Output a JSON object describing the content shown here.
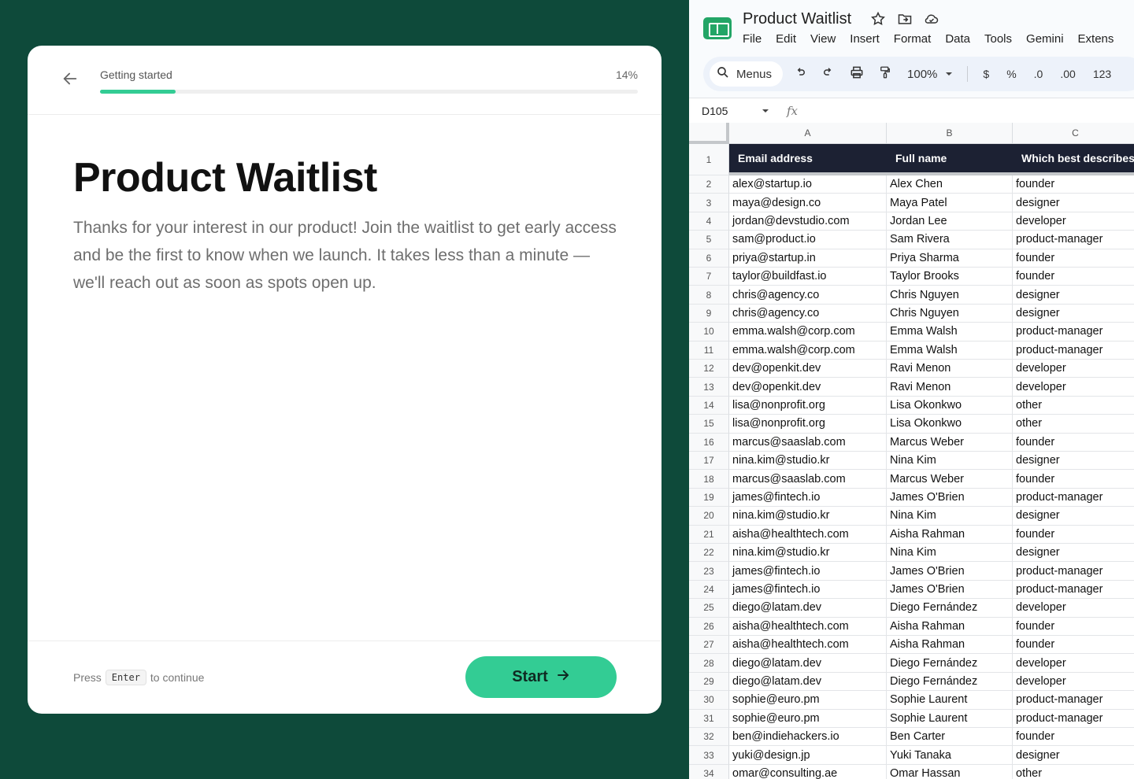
{
  "form": {
    "back_icon": "arrow-left-icon",
    "progress_label": "Getting started",
    "progress_percent": "14%",
    "progress_value": 0.14,
    "title": "Product Waitlist",
    "description": "Thanks for your interest in our product! Join the waitlist to get early access and be the first to know when we launch. It takes less than a minute — we'll reach out as soon as spots open up.",
    "hint_press": "Press",
    "hint_key": "Enter",
    "hint_continue": "to continue",
    "start_label": "Start",
    "start_icon": "arrow-right-icon",
    "accent_color": "#33cc94"
  },
  "sheet": {
    "title": "Product Waitlist",
    "menu": [
      "File",
      "Edit",
      "View",
      "Insert",
      "Format",
      "Data",
      "Tools",
      "Gemini",
      "Extens"
    ],
    "toolbar": {
      "search_label": "Menus",
      "zoom": "100%",
      "currency": "$",
      "percent": "%",
      "decrease_decimal": ".0",
      "increase_decimal": ".00",
      "number_format": "123"
    },
    "name_box": "D105",
    "fx_label": "fx",
    "columns": [
      "A",
      "B",
      "C"
    ],
    "headers": [
      "Email address",
      "Full name",
      "Which best describes you?"
    ],
    "rows": [
      [
        "2",
        "alex@startup.io",
        "Alex Chen",
        "founder"
      ],
      [
        "3",
        "maya@design.co",
        "Maya Patel",
        "designer"
      ],
      [
        "4",
        "jordan@devstudio.com",
        "Jordan Lee",
        "developer"
      ],
      [
        "5",
        "sam@product.io",
        "Sam Rivera",
        "product-manager"
      ],
      [
        "6",
        "priya@startup.in",
        "Priya Sharma",
        "founder"
      ],
      [
        "7",
        "taylor@buildfast.io",
        "Taylor Brooks",
        "founder"
      ],
      [
        "8",
        "chris@agency.co",
        "Chris Nguyen",
        "designer"
      ],
      [
        "9",
        "chris@agency.co",
        "Chris Nguyen",
        "designer"
      ],
      [
        "10",
        "emma.walsh@corp.com",
        "Emma Walsh",
        "product-manager"
      ],
      [
        "11",
        "emma.walsh@corp.com",
        "Emma Walsh",
        "product-manager"
      ],
      [
        "12",
        "dev@openkit.dev",
        "Ravi Menon",
        "developer"
      ],
      [
        "13",
        "dev@openkit.dev",
        "Ravi Menon",
        "developer"
      ],
      [
        "14",
        "lisa@nonprofit.org",
        "Lisa Okonkwo",
        "other"
      ],
      [
        "15",
        "lisa@nonprofit.org",
        "Lisa Okonkwo",
        "other"
      ],
      [
        "16",
        "marcus@saaslab.com",
        "Marcus Weber",
        "founder"
      ],
      [
        "17",
        "nina.kim@studio.kr",
        "Nina Kim",
        "designer"
      ],
      [
        "18",
        "marcus@saaslab.com",
        "Marcus Weber",
        "founder"
      ],
      [
        "19",
        "james@fintech.io",
        "James O'Brien",
        "product-manager"
      ],
      [
        "20",
        "nina.kim@studio.kr",
        "Nina Kim",
        "designer"
      ],
      [
        "21",
        "aisha@healthtech.com",
        "Aisha Rahman",
        "founder"
      ],
      [
        "22",
        "nina.kim@studio.kr",
        "Nina Kim",
        "designer"
      ],
      [
        "23",
        "james@fintech.io",
        "James O'Brien",
        "product-manager"
      ],
      [
        "24",
        "james@fintech.io",
        "James O'Brien",
        "product-manager"
      ],
      [
        "25",
        "diego@latam.dev",
        "Diego Fernández",
        "developer"
      ],
      [
        "26",
        "aisha@healthtech.com",
        "Aisha Rahman",
        "founder"
      ],
      [
        "27",
        "aisha@healthtech.com",
        "Aisha Rahman",
        "founder"
      ],
      [
        "28",
        "diego@latam.dev",
        "Diego Fernández",
        "developer"
      ],
      [
        "29",
        "diego@latam.dev",
        "Diego Fernández",
        "developer"
      ],
      [
        "30",
        "sophie@euro.pm",
        "Sophie Laurent",
        "product-manager"
      ],
      [
        "31",
        "sophie@euro.pm",
        "Sophie Laurent",
        "product-manager"
      ],
      [
        "32",
        "ben@indiehackers.io",
        "Ben Carter",
        "founder"
      ],
      [
        "33",
        "yuki@design.jp",
        "Yuki Tanaka",
        "designer"
      ],
      [
        "34",
        "omar@consulting.ae",
        "Omar Hassan",
        "other"
      ]
    ]
  }
}
